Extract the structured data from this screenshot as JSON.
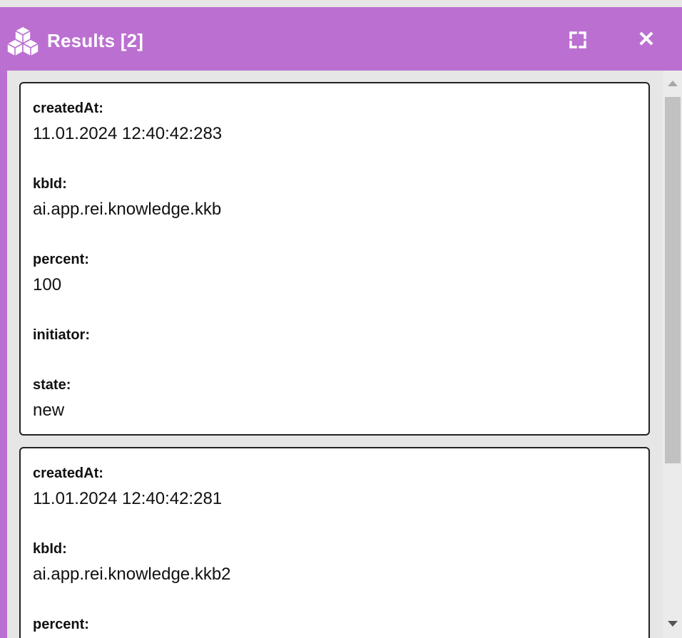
{
  "header": {
    "title": "Results [2]",
    "icon": "cubes-icon",
    "maximize_icon": "maximize-icon",
    "close_label": "✕"
  },
  "colors": {
    "header_bg": "#bb70d1",
    "panel_bg": "#e6e6e6",
    "card_bg": "#ffffff",
    "card_border": "#222222"
  },
  "results": [
    {
      "createdAt_label": "createdAt:",
      "createdAt": "11.01.2024 12:40:42:283",
      "kbId_label": "kbId:",
      "kbId": "ai.app.rei.knowledge.kkb",
      "percent_label": "percent:",
      "percent": "100",
      "initiator_label": "initiator:",
      "initiator": "",
      "state_label": "state:",
      "state": "new"
    },
    {
      "createdAt_label": "createdAt:",
      "createdAt": "11.01.2024 12:40:42:281",
      "kbId_label": "kbId:",
      "kbId": "ai.app.rei.knowledge.kkb2",
      "percent_label": "percent:"
    }
  ]
}
